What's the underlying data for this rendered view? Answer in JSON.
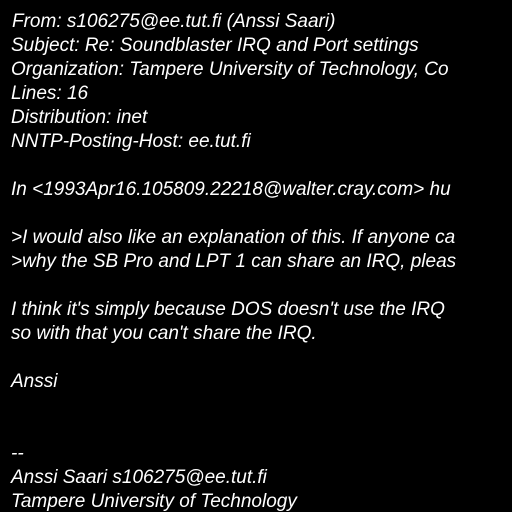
{
  "header": {
    "from": "From: s106275@ee.tut.fi (Anssi Saari)",
    "subject": "Subject: Re: Soundblaster IRQ and Port settings",
    "organization": "Organization: Tampere University of Technology, Co",
    "lines": "Lines: 16",
    "distribution": "Distribution: inet",
    "nntp_posting_host": "NNTP-Posting-Host: ee.tut.fi"
  },
  "body": {
    "attribution": "In <1993Apr16.105809.22218@walter.cray.com> hu",
    "quote_line_1": ">I would also like an explanation of this. If anyone ca",
    "quote_line_2": ">why the SB Pro and LPT 1 can share an IRQ, pleas",
    "reply_line_1": "I think it's simply because DOS doesn't use the IRQ",
    "reply_line_2": "so with that you can't share the IRQ.",
    "sign_off": "Anssi"
  },
  "signature": {
    "separator": "--",
    "name_email": "Anssi Saari s106275@ee.tut.fi",
    "affiliation": "Tampere University of Technology"
  },
  "colors": {
    "background": "#000000",
    "text": "#ffffff"
  }
}
